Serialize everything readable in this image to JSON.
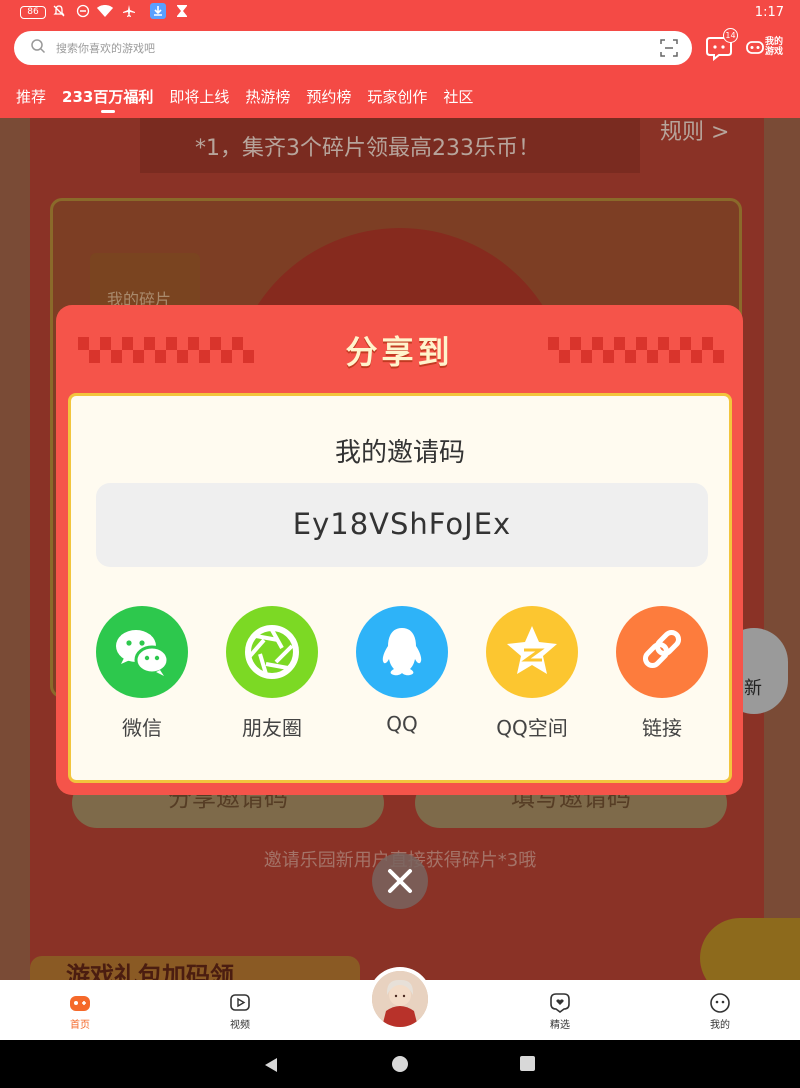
{
  "status_bar": {
    "battery": "86",
    "time": "1:17"
  },
  "header": {
    "search_placeholder": "搜索你喜欢的游戏吧",
    "message_badge": "14",
    "my_games_label": "我的游戏",
    "tabs": [
      {
        "label": "推荐",
        "active": false
      },
      {
        "label": "233百万福利",
        "active": true
      },
      {
        "label": "即将上线",
        "active": false
      },
      {
        "label": "热游榜",
        "active": false
      },
      {
        "label": "预约榜",
        "active": false
      },
      {
        "label": "玩家创作",
        "active": false
      },
      {
        "label": "社区",
        "active": false
      }
    ]
  },
  "background": {
    "banner_text": "*1，集齐3个碎片领最高233乐币！",
    "rules_link": "规则 >",
    "my_fragments": "我的碎片",
    "share_invite_button": "分享邀请码",
    "fill_invite_button": "填写邀请码",
    "invite_hint": "邀请乐园新用户直接获得碎片*3哦",
    "gift_code_banner": "游戏礼包加码领",
    "refresh_label": "新"
  },
  "dialog": {
    "title": "分享到",
    "invite_label": "我的邀请码",
    "invite_code": "Ey18VShFoJEx",
    "share_targets": [
      {
        "label": "微信",
        "icon": "wechat-icon",
        "color": "#2dc84d"
      },
      {
        "label": "朋友圈",
        "icon": "moments-icon",
        "color": "#7cd924"
      },
      {
        "label": "QQ",
        "icon": "qq-icon",
        "color": "#2eb3f8"
      },
      {
        "label": "QQ空间",
        "icon": "qzone-icon",
        "color": "#fcc630"
      },
      {
        "label": "链接",
        "icon": "link-icon",
        "color": "#fd7c3d"
      }
    ]
  },
  "bottom_nav": {
    "items": [
      {
        "label": "首页",
        "active": true
      },
      {
        "label": "视频",
        "active": false
      },
      {
        "label": "精选",
        "active": false
      },
      {
        "label": "我的",
        "active": false
      }
    ]
  },
  "colors": {
    "brand_red": "#f44a45",
    "dialog_red": "#f5544a",
    "gold_border": "#f2c53d",
    "active_orange": "#f5692a"
  }
}
